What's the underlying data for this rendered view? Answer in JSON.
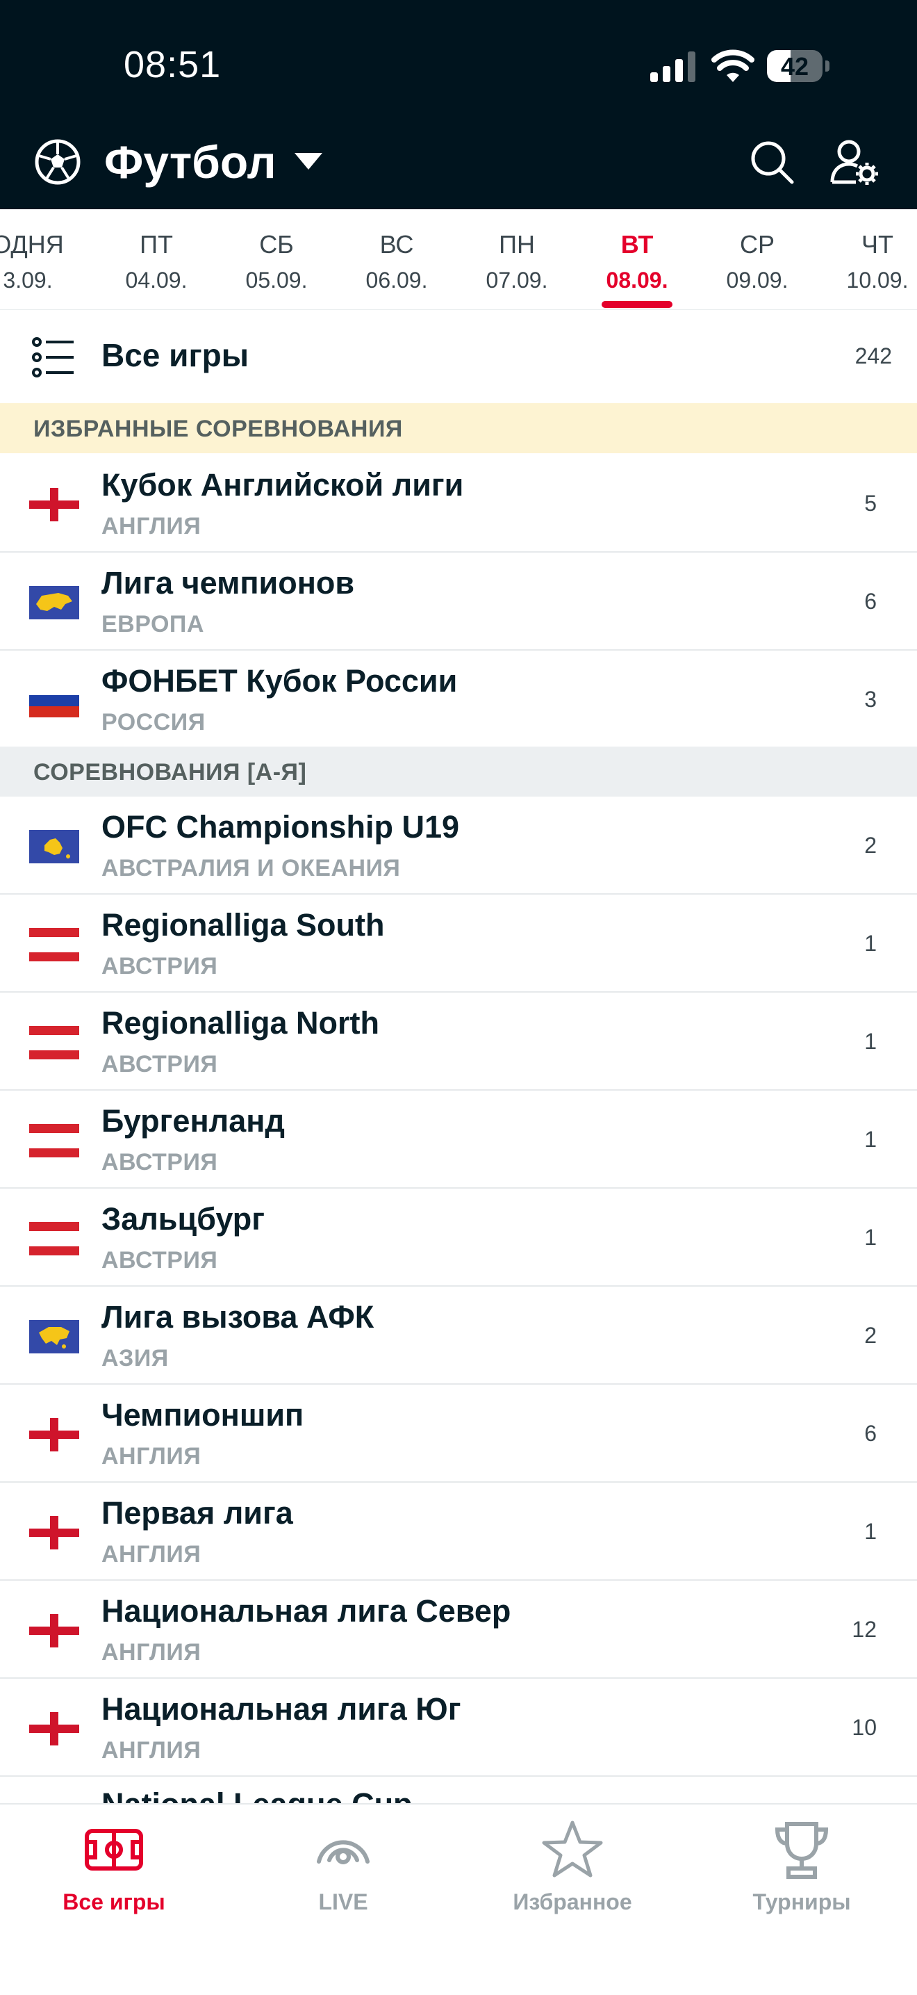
{
  "status": {
    "time": "08:51",
    "battery": "42",
    "battery_level": 0.42
  },
  "header": {
    "title": "Футбол"
  },
  "dates": [
    {
      "day": "ОДНЯ",
      "date": "3.09."
    },
    {
      "day": "ПТ",
      "date": "04.09."
    },
    {
      "day": "СБ",
      "date": "05.09."
    },
    {
      "day": "ВС",
      "date": "06.09."
    },
    {
      "day": "ПН",
      "date": "07.09."
    },
    {
      "day": "ВТ",
      "date": "08.09.",
      "active": true
    },
    {
      "day": "СР",
      "date": "09.09."
    },
    {
      "day": "ЧТ",
      "date": "10.09."
    }
  ],
  "all_games": {
    "label": "Все игры",
    "count": "242"
  },
  "sections": {
    "favorites": "ИЗБРАННЫЕ СОРЕВНОВАНИЯ",
    "az": "СОРЕВНОВАНИЯ [А-Я]"
  },
  "favorites": [
    {
      "name": "Кубок Английской лиги",
      "country": "АНГЛИЯ",
      "count": "5",
      "flag": "england"
    },
    {
      "name": "Лига чемпионов",
      "country": "ЕВРОПА",
      "count": "6",
      "flag": "europe"
    },
    {
      "name": "ФОНБЕТ Кубок России",
      "country": "РОССИЯ",
      "count": "3",
      "flag": "russia"
    }
  ],
  "competitions": [
    {
      "name": "OFC Championship U19",
      "country": "АВСТРАЛИЯ И ОКЕАНИЯ",
      "count": "2",
      "flag": "oceania"
    },
    {
      "name": "Regionalliga South",
      "country": "АВСТРИЯ",
      "count": "1",
      "flag": "austria"
    },
    {
      "name": "Regionalliga North",
      "country": "АВСТРИЯ",
      "count": "1",
      "flag": "austria"
    },
    {
      "name": "Бургенланд",
      "country": "АВСТРИЯ",
      "count": "1",
      "flag": "austria"
    },
    {
      "name": "Зальцбург",
      "country": "АВСТРИЯ",
      "count": "1",
      "flag": "austria"
    },
    {
      "name": "Лига вызова АФК",
      "country": "АЗИЯ",
      "count": "2",
      "flag": "asia"
    },
    {
      "name": "Чемпионшип",
      "country": "АНГЛИЯ",
      "count": "6",
      "flag": "england"
    },
    {
      "name": "Первая лига",
      "country": "АНГЛИЯ",
      "count": "1",
      "flag": "england"
    },
    {
      "name": "Национальная лига Север",
      "country": "АНГЛИЯ",
      "count": "12",
      "flag": "england"
    },
    {
      "name": "Национальная лига Юг",
      "country": "АНГЛИЯ",
      "count": "10",
      "flag": "england"
    }
  ],
  "partial_row": "National League Cup",
  "nav": [
    {
      "label": "Все игры",
      "icon": "field-icon",
      "active": true
    },
    {
      "label": "LIVE",
      "icon": "live-icon"
    },
    {
      "label": "Избранное",
      "icon": "star-icon"
    },
    {
      "label": "Турниры",
      "icon": "trophy-icon"
    }
  ],
  "colors": {
    "header_bg": "#00141e",
    "accent": "#e4002b",
    "favorites_bg": "#fdf3d2"
  }
}
